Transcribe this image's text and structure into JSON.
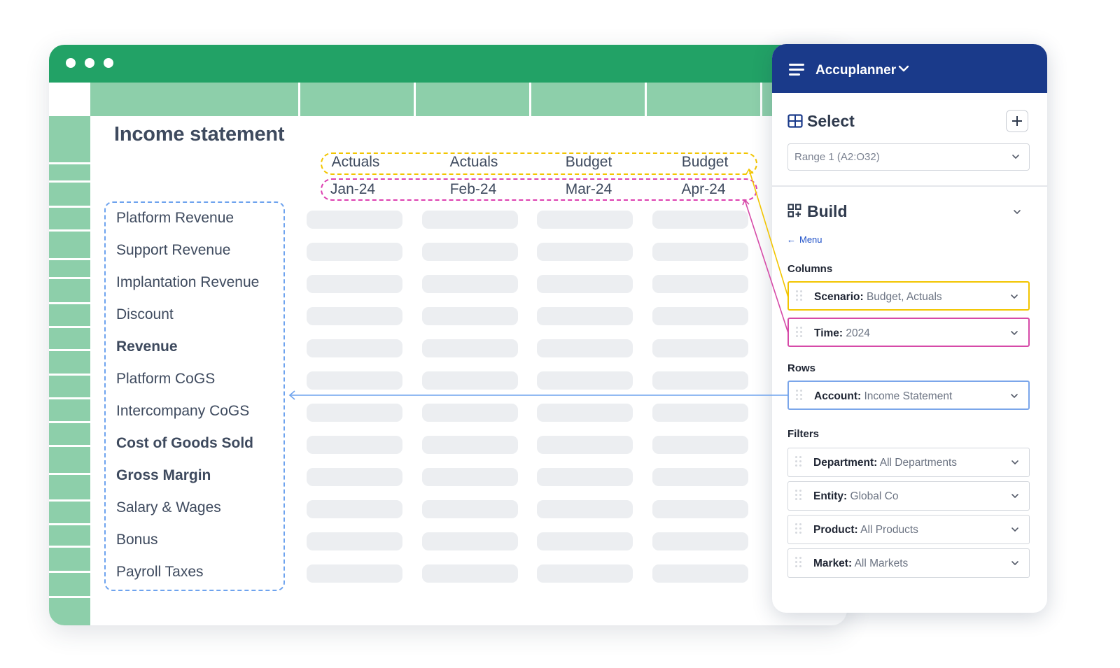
{
  "window": {
    "controls": [
      "close-dot",
      "minimize-dot",
      "maximize-dot"
    ]
  },
  "sheet": {
    "title": "Income statement",
    "columns": [
      {
        "scenario": "Actuals",
        "period": "Jan-24"
      },
      {
        "scenario": "Actuals",
        "period": "Feb-24"
      },
      {
        "scenario": "Budget",
        "period": "Mar-24"
      },
      {
        "scenario": "Budget",
        "period": "Apr-24"
      }
    ],
    "rows": [
      {
        "label": "Platform Revenue",
        "bold": false
      },
      {
        "label": "Support Revenue",
        "bold": false
      },
      {
        "label": "Implantation Revenue",
        "bold": false
      },
      {
        "label": "Discount",
        "bold": false
      },
      {
        "label": "Revenue",
        "bold": true
      },
      {
        "label": "Platform CoGS",
        "bold": false
      },
      {
        "label": "Intercompany CoGS",
        "bold": false
      },
      {
        "label": "Cost of Goods Sold",
        "bold": true
      },
      {
        "label": "Gross Margin",
        "bold": true
      },
      {
        "label": "Salary & Wages",
        "bold": false
      },
      {
        "label": "Bonus",
        "bold": false
      },
      {
        "label": "Payroll Taxes",
        "bold": false
      }
    ]
  },
  "panel": {
    "app_name": "Accuplanner",
    "select": {
      "title": "Select",
      "range_value": "Range 1 (A2:O32)"
    },
    "build": {
      "title": "Build",
      "menu_link": "Menu",
      "columns_label": "Columns",
      "rows_label": "Rows",
      "filters_label": "Filters",
      "columns": [
        {
          "key": "Scenario:",
          "value": " Budget, Actuals",
          "accent": "yellow"
        },
        {
          "key": "Time:",
          "value": " 2024",
          "accent": "pink"
        }
      ],
      "rows": [
        {
          "key": "Account:",
          "value": " Income Statement",
          "accent": "blue"
        }
      ],
      "filters": [
        {
          "key": "Department:",
          "value": " All Departments"
        },
        {
          "key": "Entity:",
          "value": " Global Co"
        },
        {
          "key": "Product:",
          "value": " All Products"
        },
        {
          "key": "Market:",
          "value": " All Markets"
        }
      ]
    }
  },
  "colors": {
    "titlebar_green": "#22a266",
    "grid_green": "#8dcfaa",
    "panel_navy": "#1a3a8a",
    "scenario_yellow": "#f2c500",
    "time_pink": "#dd41b1",
    "account_blue": "#6ea3ee"
  }
}
